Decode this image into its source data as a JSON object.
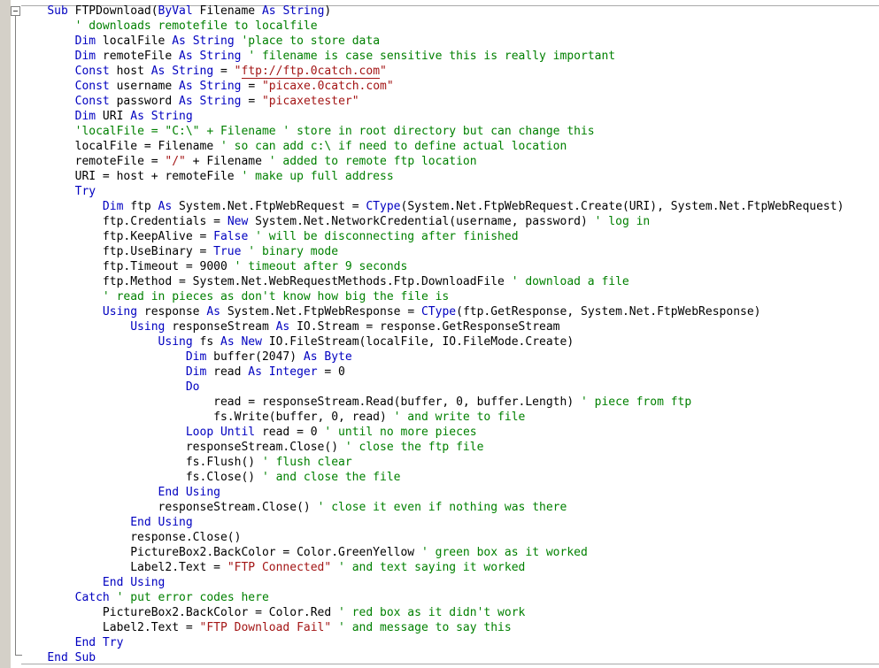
{
  "editor": {
    "language": "Visual Basic .NET",
    "colors": {
      "keyword": "#0000c0",
      "comment": "#008000",
      "string": "#a31515",
      "identifier": "#000000",
      "background": "#ffffff",
      "gutter": "#d4d0c8",
      "outline_line": "#808080"
    },
    "outlining": {
      "collapse_glyph": "minus-box",
      "region_start_line": 1,
      "region_end_line": 44
    }
  },
  "code": {
    "lines": [
      {
        "indent": 4,
        "tokens": [
          {
            "t": "kw",
            "v": "Sub"
          },
          {
            "t": "id",
            "v": " FTPDownload("
          },
          {
            "t": "kw",
            "v": "ByVal"
          },
          {
            "t": "id",
            "v": " Filename "
          },
          {
            "t": "kw",
            "v": "As"
          },
          {
            "t": "id",
            "v": " "
          },
          {
            "t": "kw",
            "v": "String"
          },
          {
            "t": "id",
            "v": ")"
          }
        ]
      },
      {
        "indent": 8,
        "tokens": [
          {
            "t": "cmt",
            "v": "' downloads remotefile to localfile"
          }
        ]
      },
      {
        "indent": 8,
        "tokens": [
          {
            "t": "kw",
            "v": "Dim"
          },
          {
            "t": "id",
            "v": " localFile "
          },
          {
            "t": "kw",
            "v": "As"
          },
          {
            "t": "id",
            "v": " "
          },
          {
            "t": "kw",
            "v": "String"
          },
          {
            "t": "id",
            "v": " "
          },
          {
            "t": "cmt",
            "v": "'place to store data"
          }
        ]
      },
      {
        "indent": 8,
        "tokens": [
          {
            "t": "kw",
            "v": "Dim"
          },
          {
            "t": "id",
            "v": " remoteFile "
          },
          {
            "t": "kw",
            "v": "As"
          },
          {
            "t": "id",
            "v": " "
          },
          {
            "t": "kw",
            "v": "String"
          },
          {
            "t": "id",
            "v": " "
          },
          {
            "t": "cmt",
            "v": "' filename is case sensitive this is really important"
          }
        ]
      },
      {
        "indent": 8,
        "tokens": [
          {
            "t": "kw",
            "v": "Const"
          },
          {
            "t": "id",
            "v": " host "
          },
          {
            "t": "kw",
            "v": "As"
          },
          {
            "t": "id",
            "v": " "
          },
          {
            "t": "kw",
            "v": "String"
          },
          {
            "t": "id",
            "v": " = "
          },
          {
            "t": "str",
            "v": "\""
          },
          {
            "t": "str-underline",
            "v": "ftp://ftp.0catch.com"
          },
          {
            "t": "str",
            "v": "\""
          }
        ]
      },
      {
        "indent": 8,
        "tokens": [
          {
            "t": "kw",
            "v": "Const"
          },
          {
            "t": "id",
            "v": " username "
          },
          {
            "t": "kw",
            "v": "As"
          },
          {
            "t": "id",
            "v": " "
          },
          {
            "t": "kw",
            "v": "String"
          },
          {
            "t": "id",
            "v": " = "
          },
          {
            "t": "str",
            "v": "\"picaxe.0catch.com\""
          }
        ]
      },
      {
        "indent": 8,
        "tokens": [
          {
            "t": "kw",
            "v": "Const"
          },
          {
            "t": "id",
            "v": " password "
          },
          {
            "t": "kw",
            "v": "As"
          },
          {
            "t": "id",
            "v": " "
          },
          {
            "t": "kw",
            "v": "String"
          },
          {
            "t": "id",
            "v": " = "
          },
          {
            "t": "str",
            "v": "\"picaxetester\""
          }
        ]
      },
      {
        "indent": 8,
        "tokens": [
          {
            "t": "kw",
            "v": "Dim"
          },
          {
            "t": "id",
            "v": " URI "
          },
          {
            "t": "kw",
            "v": "As"
          },
          {
            "t": "id",
            "v": " "
          },
          {
            "t": "kw",
            "v": "String"
          }
        ]
      },
      {
        "indent": 8,
        "tokens": [
          {
            "t": "cmt",
            "v": "'localFile = \"C:\\\" + Filename ' store in root directory but can change this"
          }
        ]
      },
      {
        "indent": 8,
        "tokens": [
          {
            "t": "id",
            "v": "localFile = Filename "
          },
          {
            "t": "cmt",
            "v": "' so can add c:\\ if need to define actual location"
          }
        ]
      },
      {
        "indent": 8,
        "tokens": [
          {
            "t": "id",
            "v": "remoteFile = "
          },
          {
            "t": "str",
            "v": "\"/\""
          },
          {
            "t": "id",
            "v": " + Filename "
          },
          {
            "t": "cmt",
            "v": "' added to remote ftp location"
          }
        ]
      },
      {
        "indent": 8,
        "tokens": [
          {
            "t": "id",
            "v": "URI = host + remoteFile "
          },
          {
            "t": "cmt",
            "v": "' make up full address"
          }
        ]
      },
      {
        "indent": 8,
        "tokens": [
          {
            "t": "kw",
            "v": "Try"
          }
        ]
      },
      {
        "indent": 12,
        "tokens": [
          {
            "t": "kw",
            "v": "Dim"
          },
          {
            "t": "id",
            "v": " ftp "
          },
          {
            "t": "kw",
            "v": "As"
          },
          {
            "t": "id",
            "v": " System.Net.FtpWebRequest = "
          },
          {
            "t": "kw",
            "v": "CType"
          },
          {
            "t": "id",
            "v": "(System.Net.FtpWebRequest.Create(URI), System.Net.FtpWebRequest)"
          }
        ]
      },
      {
        "indent": 12,
        "tokens": [
          {
            "t": "id",
            "v": "ftp.Credentials = "
          },
          {
            "t": "kw",
            "v": "New"
          },
          {
            "t": "id",
            "v": " System.Net.NetworkCredential(username, password) "
          },
          {
            "t": "cmt",
            "v": "' log in"
          }
        ]
      },
      {
        "indent": 12,
        "tokens": [
          {
            "t": "id",
            "v": "ftp.KeepAlive = "
          },
          {
            "t": "kw",
            "v": "False"
          },
          {
            "t": "id",
            "v": " "
          },
          {
            "t": "cmt",
            "v": "' will be disconnecting after finished"
          }
        ]
      },
      {
        "indent": 12,
        "tokens": [
          {
            "t": "id",
            "v": "ftp.UseBinary = "
          },
          {
            "t": "kw",
            "v": "True"
          },
          {
            "t": "id",
            "v": " "
          },
          {
            "t": "cmt",
            "v": "' binary mode"
          }
        ]
      },
      {
        "indent": 12,
        "tokens": [
          {
            "t": "id",
            "v": "ftp.Timeout = 9000 "
          },
          {
            "t": "cmt",
            "v": "' timeout after 9 seconds"
          }
        ]
      },
      {
        "indent": 12,
        "tokens": [
          {
            "t": "id",
            "v": "ftp.Method = System.Net.WebRequestMethods.Ftp.DownloadFile "
          },
          {
            "t": "cmt",
            "v": "' download a file"
          }
        ]
      },
      {
        "indent": 12,
        "tokens": [
          {
            "t": "cmt",
            "v": "' read in pieces as don't know how big the file is"
          }
        ]
      },
      {
        "indent": 12,
        "tokens": [
          {
            "t": "kw",
            "v": "Using"
          },
          {
            "t": "id",
            "v": " response "
          },
          {
            "t": "kw",
            "v": "As"
          },
          {
            "t": "id",
            "v": " System.Net.FtpWebResponse = "
          },
          {
            "t": "kw",
            "v": "CType"
          },
          {
            "t": "id",
            "v": "(ftp.GetResponse, System.Net.FtpWebResponse)"
          }
        ]
      },
      {
        "indent": 16,
        "tokens": [
          {
            "t": "kw",
            "v": "Using"
          },
          {
            "t": "id",
            "v": " responseStream "
          },
          {
            "t": "kw",
            "v": "As"
          },
          {
            "t": "id",
            "v": " IO.Stream = response.GetResponseStream"
          }
        ]
      },
      {
        "indent": 20,
        "tokens": [
          {
            "t": "kw",
            "v": "Using"
          },
          {
            "t": "id",
            "v": " fs "
          },
          {
            "t": "kw",
            "v": "As"
          },
          {
            "t": "id",
            "v": " "
          },
          {
            "t": "kw",
            "v": "New"
          },
          {
            "t": "id",
            "v": " IO.FileStream(localFile, IO.FileMode.Create)"
          }
        ]
      },
      {
        "indent": 24,
        "tokens": [
          {
            "t": "kw",
            "v": "Dim"
          },
          {
            "t": "id",
            "v": " buffer(2047) "
          },
          {
            "t": "kw",
            "v": "As"
          },
          {
            "t": "id",
            "v": " "
          },
          {
            "t": "kw",
            "v": "Byte"
          }
        ]
      },
      {
        "indent": 24,
        "tokens": [
          {
            "t": "kw",
            "v": "Dim"
          },
          {
            "t": "id",
            "v": " read "
          },
          {
            "t": "kw",
            "v": "As"
          },
          {
            "t": "id",
            "v": " "
          },
          {
            "t": "kw",
            "v": "Integer"
          },
          {
            "t": "id",
            "v": " = 0"
          }
        ]
      },
      {
        "indent": 24,
        "tokens": [
          {
            "t": "kw",
            "v": "Do"
          }
        ]
      },
      {
        "indent": 28,
        "tokens": [
          {
            "t": "id",
            "v": "read = responseStream.Read(buffer, 0, buffer.Length) "
          },
          {
            "t": "cmt",
            "v": "' piece from ftp"
          }
        ]
      },
      {
        "indent": 28,
        "tokens": [
          {
            "t": "id",
            "v": "fs.Write(buffer, 0, read) "
          },
          {
            "t": "cmt",
            "v": "' and write to file"
          }
        ]
      },
      {
        "indent": 24,
        "tokens": [
          {
            "t": "kw",
            "v": "Loop Until"
          },
          {
            "t": "id",
            "v": " read = 0 "
          },
          {
            "t": "cmt",
            "v": "' until no more pieces"
          }
        ]
      },
      {
        "indent": 24,
        "tokens": [
          {
            "t": "id",
            "v": "responseStream.Close() "
          },
          {
            "t": "cmt",
            "v": "' close the ftp file"
          }
        ]
      },
      {
        "indent": 24,
        "tokens": [
          {
            "t": "id",
            "v": "fs.Flush() "
          },
          {
            "t": "cmt",
            "v": "' flush clear"
          }
        ]
      },
      {
        "indent": 24,
        "tokens": [
          {
            "t": "id",
            "v": "fs.Close() "
          },
          {
            "t": "cmt",
            "v": "' and close the file"
          }
        ]
      },
      {
        "indent": 20,
        "tokens": [
          {
            "t": "kw",
            "v": "End Using"
          }
        ]
      },
      {
        "indent": 20,
        "tokens": [
          {
            "t": "id",
            "v": "responseStream.Close() "
          },
          {
            "t": "cmt",
            "v": "' close it even if nothing was there"
          }
        ]
      },
      {
        "indent": 16,
        "tokens": [
          {
            "t": "kw",
            "v": "End Using"
          }
        ]
      },
      {
        "indent": 16,
        "tokens": [
          {
            "t": "id",
            "v": "response.Close()"
          }
        ]
      },
      {
        "indent": 16,
        "tokens": [
          {
            "t": "id",
            "v": "PictureBox2.BackColor = Color.GreenYellow "
          },
          {
            "t": "cmt",
            "v": "' green box as it worked"
          }
        ]
      },
      {
        "indent": 16,
        "tokens": [
          {
            "t": "id",
            "v": "Label2.Text = "
          },
          {
            "t": "str",
            "v": "\"FTP Connected\""
          },
          {
            "t": "id",
            "v": " "
          },
          {
            "t": "cmt",
            "v": "' and text saying it worked"
          }
        ]
      },
      {
        "indent": 12,
        "tokens": [
          {
            "t": "kw",
            "v": "End Using"
          }
        ]
      },
      {
        "indent": 8,
        "tokens": [
          {
            "t": "kw",
            "v": "Catch"
          },
          {
            "t": "id",
            "v": " "
          },
          {
            "t": "cmt",
            "v": "' put error codes here"
          }
        ]
      },
      {
        "indent": 12,
        "tokens": [
          {
            "t": "id",
            "v": "PictureBox2.BackColor = Color.Red "
          },
          {
            "t": "cmt",
            "v": "' red box as it didn't work"
          }
        ]
      },
      {
        "indent": 12,
        "tokens": [
          {
            "t": "id",
            "v": "Label2.Text = "
          },
          {
            "t": "str",
            "v": "\"FTP Download Fail\""
          },
          {
            "t": "id",
            "v": " "
          },
          {
            "t": "cmt",
            "v": "' and message to say this"
          }
        ]
      },
      {
        "indent": 8,
        "tokens": [
          {
            "t": "kw",
            "v": "End Try"
          }
        ]
      },
      {
        "indent": 4,
        "tokens": [
          {
            "t": "kw",
            "v": "End Sub"
          }
        ]
      }
    ]
  }
}
